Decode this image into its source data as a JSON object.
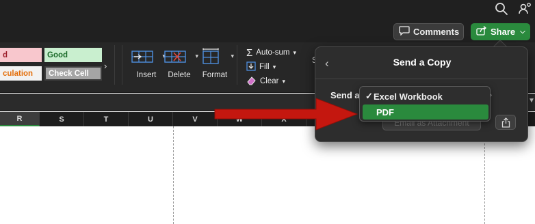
{
  "topbar": {
    "comments_label": "Comments",
    "share_label": "Share"
  },
  "ribbon": {
    "styles": {
      "bad": "d",
      "good": "Good",
      "calculation": "culation",
      "check_cell": "Check Cell"
    },
    "insert_label": "Insert",
    "delete_label": "Delete",
    "format_label": "Format",
    "autosum_label": "Auto-sum",
    "fill_label": "Fill",
    "clear_label": "Clear",
    "partial_letter": "S"
  },
  "columns": [
    "R",
    "S",
    "T",
    "U",
    "V",
    "W",
    "X"
  ],
  "selected_column": "R",
  "send_copy": {
    "title": "Send a Copy",
    "send_as_label": "Send a",
    "options": [
      "Excel Workbook",
      "PDF"
    ],
    "checked_option": "Excel Workbook",
    "highlighted_option": "PDF",
    "email_button_label": "Email as Attachment"
  },
  "colors": {
    "accent_green": "#2a8a3d",
    "annotation_red": "#c4170f"
  }
}
